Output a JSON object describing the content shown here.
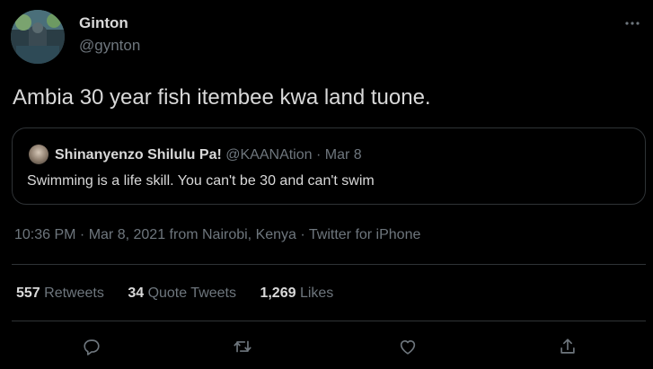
{
  "author": {
    "name": "Ginton",
    "handle": "@gynton"
  },
  "more_icon": "more-horizontal-icon",
  "tweet_text": "Ambia 30 year fish itembee kwa land tuone.",
  "quoted_tweet": {
    "name": "Shinanyenzo Shilulu Pa!",
    "handle": "@KAANAtion",
    "separator": " · ",
    "date": "Mar 8",
    "text": "Swimming is a life skill. You can't be 30 and can't swim"
  },
  "meta": {
    "time": "10:36 PM",
    "date": "Mar 8, 2021",
    "location": "from Nairobi, Kenya",
    "source": "Twitter for iPhone",
    "separator": " · "
  },
  "stats": {
    "retweets": {
      "count": "557",
      "label": "Retweets"
    },
    "quote_tweets": {
      "count": "34",
      "label": "Quote Tweets"
    },
    "likes": {
      "count": "1,269",
      "label": "Likes"
    }
  },
  "actions": [
    "reply-icon",
    "retweet-icon",
    "like-icon",
    "share-icon"
  ],
  "colors": {
    "background": "#000000",
    "text": "#d9d9d9",
    "secondary": "#6e767d",
    "border": "#2f3336"
  }
}
